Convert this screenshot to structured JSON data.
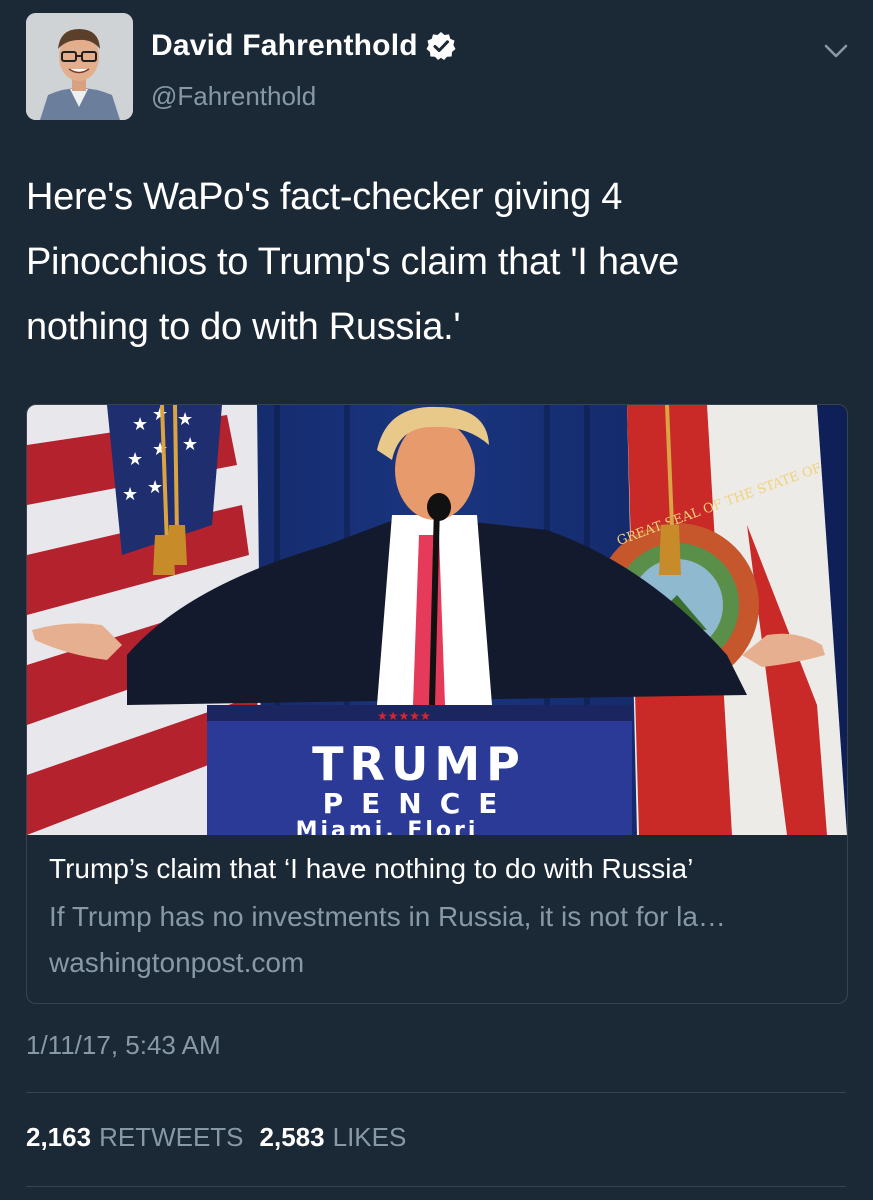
{
  "author": {
    "name": "David Fahrenthold",
    "handle": "@Fahrenthold",
    "verified": true
  },
  "icons": {
    "verified": "verified-badge-icon",
    "menu": "chevron-down-icon"
  },
  "tweet": {
    "text": "Here's WaPo's fact-checker giving 4\nPinocchios to Trump's claim that 'I have\nnothing to do with Russia.'",
    "timestamp": "1/11/17, 5:43 AM"
  },
  "card": {
    "title": "Trump’s claim that ‘I have nothing to do with Russia’",
    "description": "If Trump has no investments in Russia, it is not for la…",
    "domain": "washingtonpost.com",
    "image": {
      "lectern_line1": "TRUMP",
      "lectern_line2": "PENCE",
      "lectern_line3": "Miami, Flori",
      "seal_text": "GREAT SEAL OF THE STATE OF"
    }
  },
  "stats": {
    "retweets_count": "2,163",
    "retweets_label": "RETWEETS",
    "likes_count": "2,583",
    "likes_label": "LIKES"
  },
  "colors": {
    "background": "#1b2836",
    "secondary_text": "#8899a6",
    "divider": "#38444d"
  }
}
